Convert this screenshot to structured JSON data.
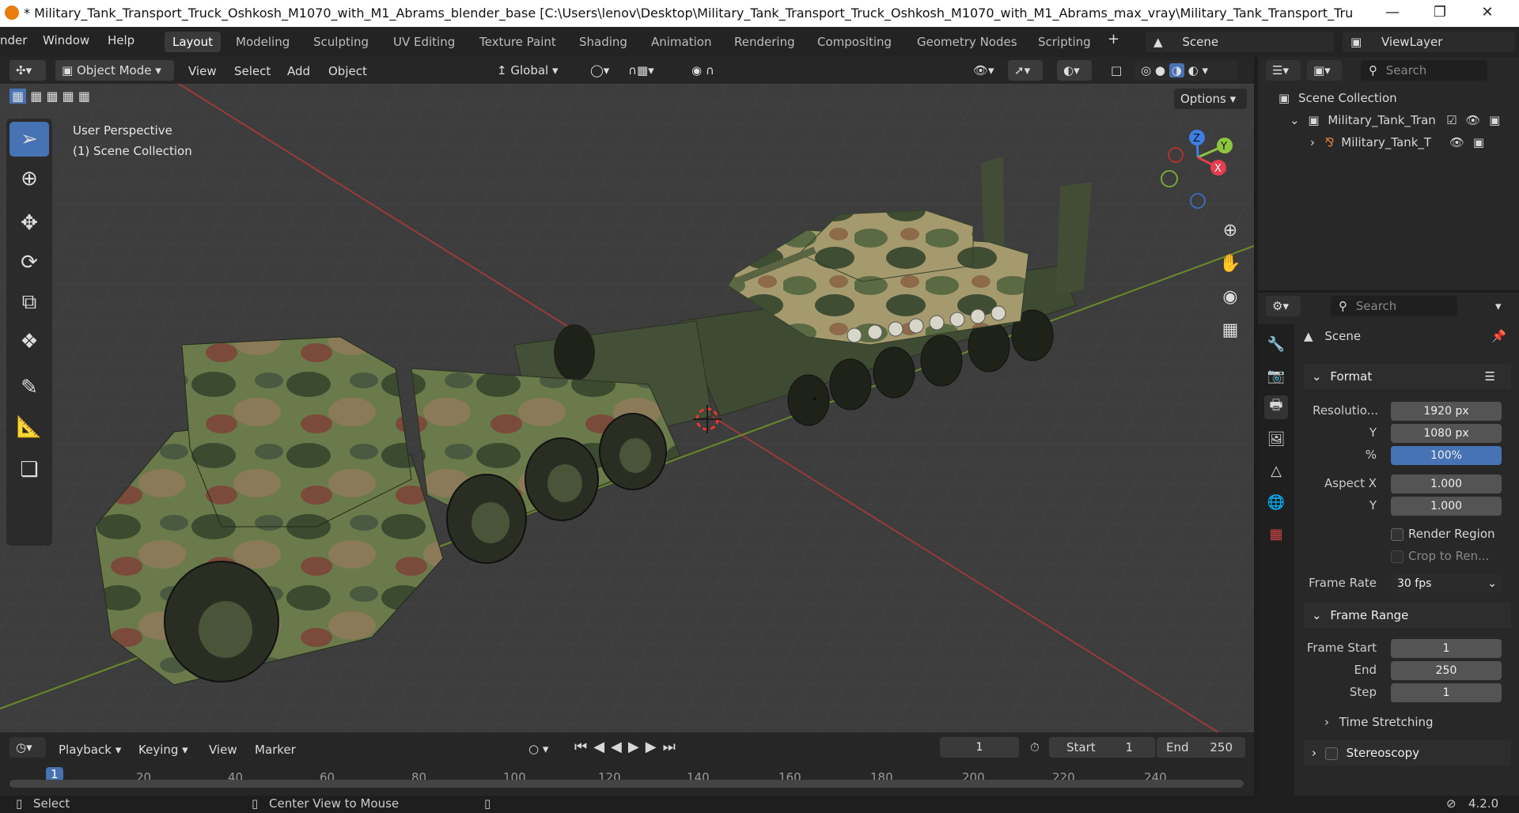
{
  "title": "* Military_Tank_Transport_Truck_Oshkosh_M1070_with_M1_Abrams_blender_base [C:\\Users\\lenov\\Desktop\\Military_Tank_Transport_Truck_Oshkosh_M1070_with_M1_Abrams_max_vray\\Military_Tank_Transport_Truck_Oshkosh_...",
  "menu": [
    "nder",
    "Window",
    "Help"
  ],
  "workspaces": [
    "Layout",
    "Modeling",
    "Sculpting",
    "UV Editing",
    "Texture Paint",
    "Shading",
    "Animation",
    "Rendering",
    "Compositing",
    "Geometry Nodes",
    "Scripting"
  ],
  "scene": "Scene",
  "viewlayer": "ViewLayer",
  "viewport_header": {
    "mode": "Object Mode",
    "view": "View",
    "select": "Select",
    "add": "Add",
    "object": "Object",
    "orientation": "Global",
    "options": "Options"
  },
  "viewport": {
    "perspective": "User Perspective",
    "collection": "(1) Scene Collection"
  },
  "gizmo": {
    "x": "X",
    "y": "Y",
    "z": "Z"
  },
  "outliner": {
    "search_placeholder": "Search",
    "scene_collection": "Scene Collection",
    "item1": "Military_Tank_Tran",
    "item2": "Military_Tank_T"
  },
  "properties": {
    "search_placeholder": "Search",
    "context": "Scene",
    "format": "Format",
    "resolution_label": "Resolutio...",
    "res_x": "1920 px",
    "y_label": "Y",
    "res_y": "1080 px",
    "pct_label": "%",
    "res_pct": "100%",
    "aspect_x_label": "Aspect X",
    "aspect_x": "1.000",
    "aspect_y": "1.000",
    "render_region": "Render Region",
    "crop": "Crop to Ren...",
    "frame_rate_label": "Frame Rate",
    "frame_rate": "30 fps",
    "frame_range": "Frame Range",
    "frame_start_label": "Frame Start",
    "frame_start": "1",
    "end_label": "End",
    "frame_end": "250",
    "step_label": "Step",
    "step": "1",
    "time_stretching": "Time Stretching",
    "stereoscopy": "Stereoscopy"
  },
  "timeline": {
    "playback": "Playback",
    "keying": "Keying",
    "view": "View",
    "marker": "Marker",
    "current": "1",
    "start_label": "Start",
    "start": "1",
    "end_label": "End",
    "end": "250",
    "ticks": [
      "1",
      "20",
      "40",
      "60",
      "80",
      "100",
      "120",
      "140",
      "160",
      "180",
      "200",
      "220",
      "240"
    ]
  },
  "status": {
    "select": "Select",
    "center": "Center View to Mouse",
    "version": "4.2.0"
  }
}
